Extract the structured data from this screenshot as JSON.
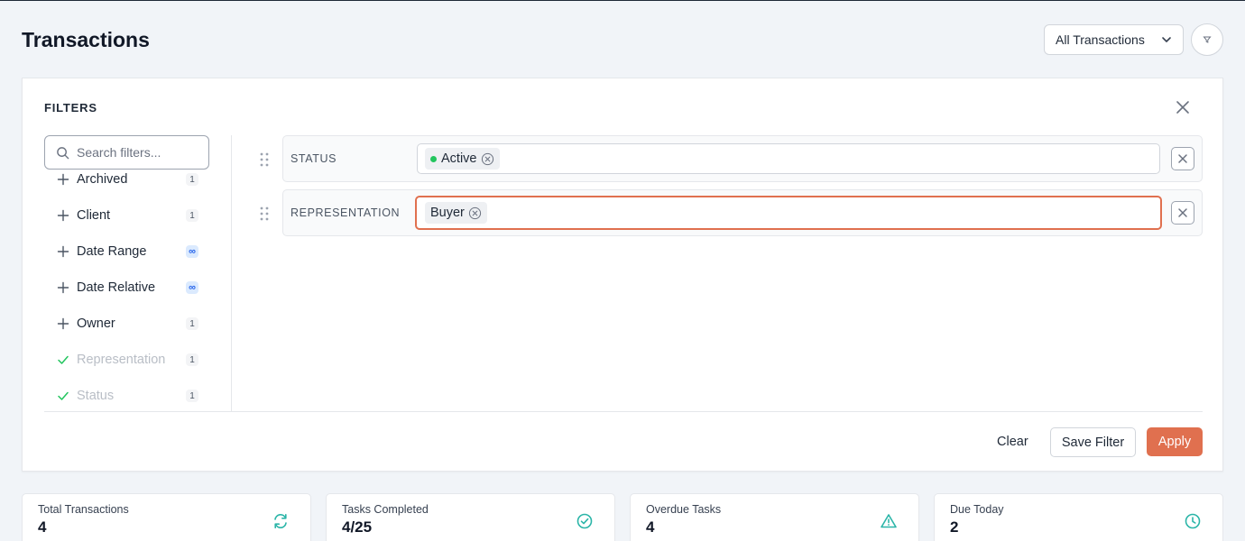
{
  "header": {
    "title": "Transactions",
    "view_select": "All Transactions"
  },
  "filters_panel": {
    "title": "FILTERS",
    "search_placeholder": "Search filters...",
    "fields": [
      {
        "label": "Archived",
        "count": "1",
        "state": "available"
      },
      {
        "label": "Client",
        "count": "1",
        "state": "available"
      },
      {
        "label": "Date Range",
        "count": "∞",
        "state": "available"
      },
      {
        "label": "Date Relative",
        "count": "∞",
        "state": "available"
      },
      {
        "label": "Owner",
        "count": "1",
        "state": "available"
      },
      {
        "label": "Representation",
        "count": "1",
        "state": "used"
      },
      {
        "label": "Status",
        "count": "1",
        "state": "used"
      }
    ],
    "rows": [
      {
        "label": "STATUS",
        "chip": "Active"
      },
      {
        "label": "REPRESENTATION",
        "chip": "Buyer"
      }
    ],
    "clear_label": "Clear",
    "save_label": "Save Filter",
    "apply_label": "Apply"
  },
  "stats": [
    {
      "label": "Total Transactions",
      "value": "4",
      "icon": "refresh-icon"
    },
    {
      "label": "Tasks Completed",
      "value": "4/25",
      "icon": "check-circle-icon"
    },
    {
      "label": "Overdue Tasks",
      "value": "4",
      "icon": "warning-icon"
    },
    {
      "label": "Due Today",
      "value": "2",
      "icon": "clock-icon"
    }
  ],
  "colors": {
    "accent": "#e0704f",
    "status_active": "#22c55e",
    "stat_icon": "#2bb5a8"
  }
}
